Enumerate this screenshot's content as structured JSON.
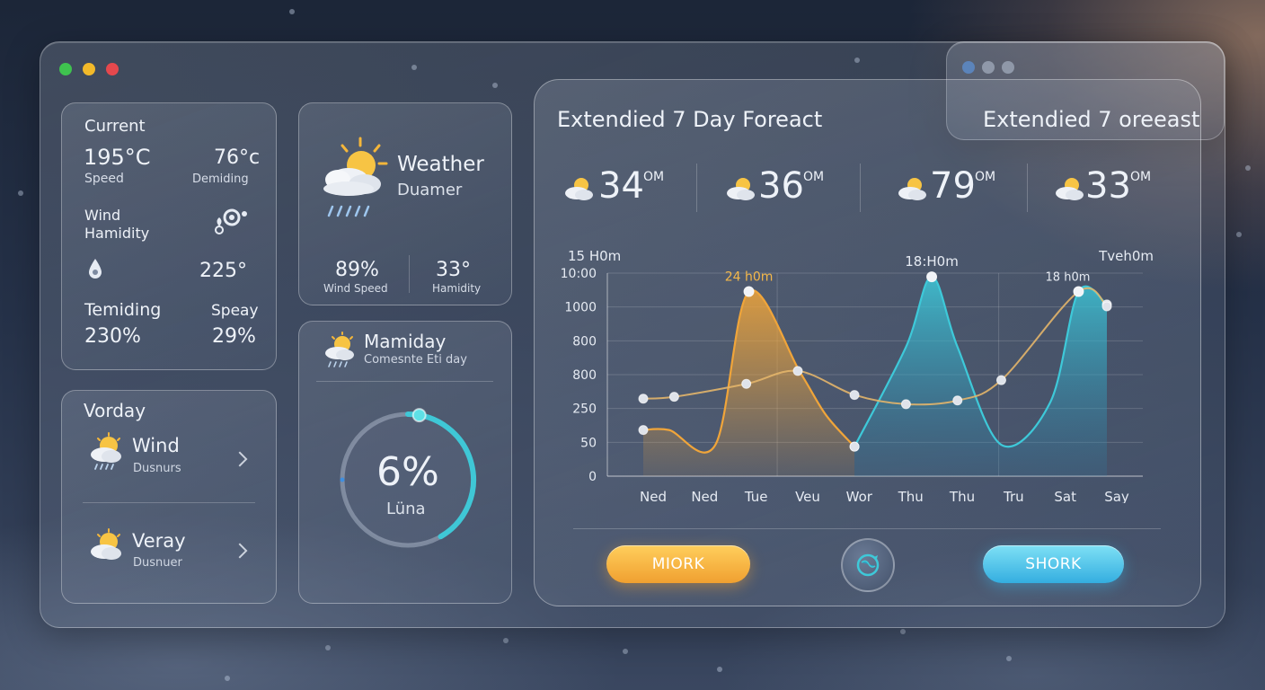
{
  "window_controls": {
    "close_color": "#e5484d",
    "minimize_color": "#f2b92a",
    "maximize_color": "#3fc24f"
  },
  "current_card": {
    "title": "Current",
    "temp_value": "195°C",
    "temp_label": "Speed",
    "side_value": "76°c",
    "side_label": "Demiding",
    "wind_label": "Wind",
    "humidity_label": "Hamidity",
    "pressure_value": "225°",
    "temiding_label": "Temiding",
    "temiding_value": "230%",
    "speay_label": "Speay",
    "speay_value": "29%"
  },
  "weather_card": {
    "title": "Weather",
    "subtitle": "Duamer",
    "wind_speed_value": "89%",
    "wind_speed_label": "Wind Speed",
    "humidity_value": "33°",
    "humidity_label": "Hamidity"
  },
  "vorday_card": {
    "title": "Vorday",
    "items": [
      {
        "title": "Wind",
        "subtitle": "Dusnurs"
      },
      {
        "title": "Veray",
        "subtitle": "Dusnuer"
      }
    ]
  },
  "mamiday_card": {
    "title": "Mamiday",
    "subtitle": "Comesnte Eti day",
    "gauge_value": "6%",
    "gauge_label": "Lüna",
    "gauge_fraction": 0.06,
    "gauge_color": "#3fc7d6"
  },
  "forecast": {
    "title_left": "Extendied 7 Day Foreact",
    "title_right": "Extendied 7 oreeast",
    "summary": [
      {
        "value": "34",
        "unit": "OM"
      },
      {
        "value": "36",
        "unit": "OM"
      },
      {
        "value": "79",
        "unit": "OM"
      },
      {
        "value": "33",
        "unit": "OM"
      }
    ],
    "buttons": {
      "left": "MIORK",
      "right": "SHORK"
    },
    "colors": {
      "orange": "#f0a53a",
      "teal": "#3ec9d9"
    }
  },
  "chart_data": {
    "type": "area",
    "categories": [
      "Ned",
      "Ned",
      "Tue",
      "Veu",
      "Wor",
      "Thu",
      "Thu",
      "Tru",
      "Sat",
      "Say"
    ],
    "y_tick_labels": [
      "10:00",
      "1000",
      "800",
      "800",
      "250",
      "50",
      "0"
    ],
    "ylim": [
      0,
      1100
    ],
    "annotations": [
      {
        "text": "15 H0m",
        "anchor": "top-left"
      },
      {
        "text": "24 h0m",
        "series": "orange-peak"
      },
      {
        "text": "18:H0m",
        "series": "teal-peak"
      },
      {
        "text": "18 h0m",
        "series": "teal-right-peak"
      },
      {
        "text": "Tveh0m",
        "anchor": "top-right"
      }
    ],
    "series": [
      {
        "x": [
          0,
          0.5,
          1.4,
          2.05,
          3.05,
          3.55,
          4.1
        ],
        "values": [
          250,
          250,
          170,
          1000,
          560,
          330,
          160
        ],
        "color": "#f0a53a"
      },
      {
        "x": [
          4.1,
          5.1,
          5.6,
          6.1,
          6.95,
          7.9,
          8.45,
          9.0
        ],
        "values": [
          160,
          700,
          1080,
          700,
          170,
          400,
          1000,
          930
        ],
        "color": "#3ec9d9"
      },
      {
        "x": [
          0,
          0.6,
          2.0,
          3.0,
          4.1,
          5.1,
          6.1,
          6.95,
          8.45,
          9.0
        ],
        "values": [
          420,
          430,
          500,
          570,
          440,
          390,
          410,
          520,
          1000,
          920
        ],
        "color": "#e3b56a"
      }
    ]
  }
}
